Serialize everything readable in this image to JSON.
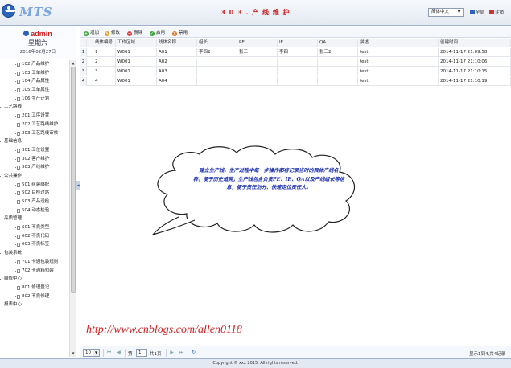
{
  "header": {
    "logo_text": "MTS",
    "title": "3 0 3 . 产 线 维 护",
    "language": "简体中文",
    "links": [
      {
        "label": "全局",
        "icon": "home-icon"
      },
      {
        "label": "注销",
        "icon": "logout-icon"
      }
    ]
  },
  "user": {
    "name": "admin",
    "weekday": "星期六",
    "date": "2016年02月27日"
  },
  "menu": [
    {
      "type": "leaf",
      "label": "102.产品维护"
    },
    {
      "type": "leaf",
      "label": "103.工单维护"
    },
    {
      "type": "leaf",
      "label": "104.产品属性"
    },
    {
      "type": "leaf",
      "label": "105.工单属性"
    },
    {
      "type": "leaf",
      "label": "106.生产计划"
    },
    {
      "type": "group",
      "label": "工艺路线"
    },
    {
      "type": "leaf",
      "label": "201.工序设置"
    },
    {
      "type": "leaf",
      "label": "202.工艺路线维护"
    },
    {
      "type": "leaf",
      "label": "203.工艺路线审核"
    },
    {
      "type": "group",
      "label": "基础信息"
    },
    {
      "type": "leaf",
      "label": "301.工位设置"
    },
    {
      "type": "leaf",
      "label": "302.客户维护"
    },
    {
      "type": "leaf",
      "label": "303.产线维护"
    },
    {
      "type": "group",
      "label": "公共操作"
    },
    {
      "type": "leaf",
      "label": "501.组装绑配"
    },
    {
      "type": "leaf",
      "label": "502.目检过站"
    },
    {
      "type": "leaf",
      "label": "503.产品送检"
    },
    {
      "type": "leaf",
      "label": "504.动态检验"
    },
    {
      "type": "group",
      "label": "品质管理"
    },
    {
      "type": "leaf",
      "label": "601.不良类型"
    },
    {
      "type": "leaf",
      "label": "602.不良代码"
    },
    {
      "type": "leaf",
      "label": "603.不良标签"
    },
    {
      "type": "group",
      "label": "包装系统"
    },
    {
      "type": "leaf",
      "label": "701.卡通包装规则"
    },
    {
      "type": "leaf",
      "label": "702.卡通箱包装"
    },
    {
      "type": "group",
      "label": "维修中心"
    },
    {
      "type": "leaf",
      "label": "801.修理登记"
    },
    {
      "type": "leaf",
      "label": "802.不良修理"
    },
    {
      "type": "group",
      "label": "报表中心"
    }
  ],
  "toolbar": [
    {
      "label": "增加",
      "icon": "add-icon",
      "color": "#3aa23a",
      "glyph": "+"
    },
    {
      "label": "修改",
      "icon": "edit-icon",
      "color": "#e0a020",
      "glyph": "✎"
    },
    {
      "label": "删除",
      "icon": "delete-icon",
      "color": "#e04040",
      "glyph": "−"
    },
    {
      "label": "启用",
      "icon": "enable-icon",
      "color": "#3aa23a",
      "glyph": "✓"
    },
    {
      "label": "禁用",
      "icon": "disable-icon",
      "color": "#e07020",
      "glyph": "×"
    }
  ],
  "table": {
    "columns": [
      "线体编号",
      "工作区域",
      "线体名称",
      "组长",
      "PE",
      "IE",
      "QA",
      "描述",
      "创建时间"
    ],
    "rows": [
      [
        "1",
        "W001",
        "A01",
        "李四2",
        "张三",
        "李四",
        "张三2",
        "test",
        "2014-11-17 21:09:58"
      ],
      [
        "2",
        "W001",
        "A02",
        "",
        "",
        "",
        "",
        "test",
        "2014-11-17 21:10:06"
      ],
      [
        "3",
        "W001",
        "A03",
        "",
        "",
        "",
        "",
        "test",
        "2014-11-17 21:10:15"
      ],
      [
        "4",
        "W001",
        "A04",
        "",
        "",
        "",
        "",
        "test",
        "2014-11-17 21:10:19"
      ]
    ]
  },
  "callout": {
    "line1": "建立生产线，生产过程中每一步操作都将记录当时的具体产线名",
    "line2": "称，便于历史追溯；生产线包含负责PE、IE、QA以及产线组长等信",
    "line3": "息，便于责任划分、快速定位责任人。"
  },
  "watermark": "http://www.cnblogs.com/allen0118",
  "pager": {
    "page_size": "10",
    "page_prefix": "第",
    "page": "1",
    "page_suffix": "共1页",
    "summary": "显示1到4,共4记录"
  },
  "footer": "Copyright © xxx 2015. All rights reserved."
}
